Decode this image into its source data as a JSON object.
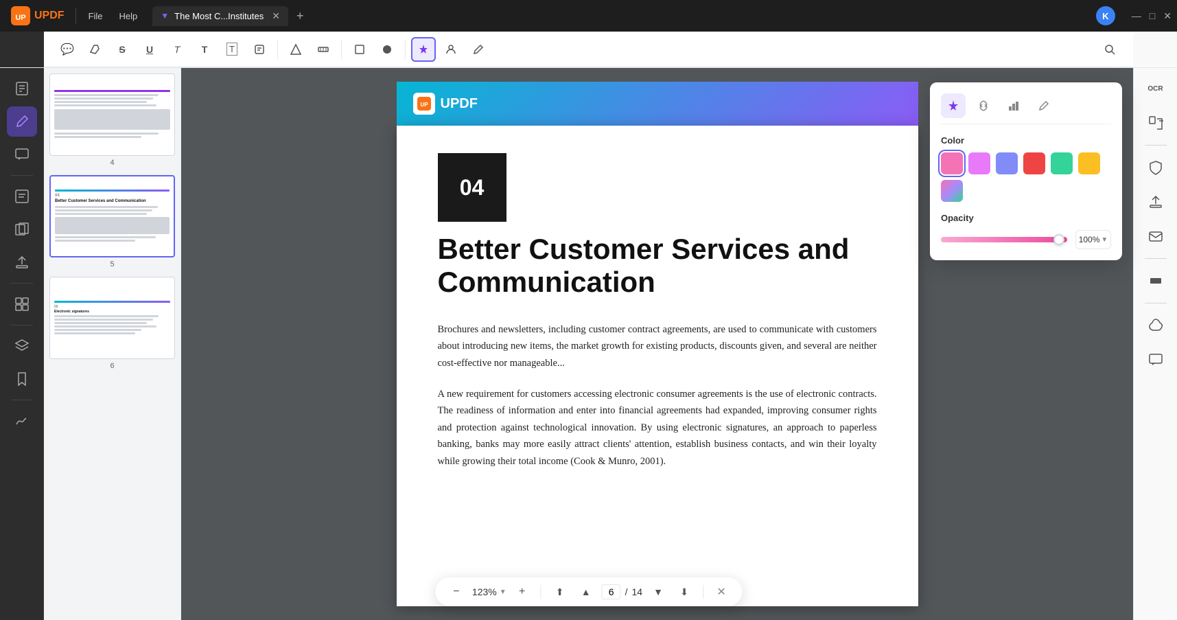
{
  "app": {
    "name": "UPDF",
    "logo_text": "UPDF"
  },
  "topbar": {
    "menu_items": [
      "File",
      "Help"
    ],
    "tab_title": "The Most C...Institutes",
    "tab_icon": "▼",
    "add_tab": "+",
    "avatar_letter": "K",
    "window_controls": [
      "—",
      "□",
      "✕"
    ]
  },
  "toolbar": {
    "tools": [
      {
        "name": "comment-icon",
        "symbol": "💬"
      },
      {
        "name": "highlight-icon",
        "symbol": "✏"
      },
      {
        "name": "strikethrough-icon",
        "symbol": "S"
      },
      {
        "name": "underline-icon",
        "symbol": "U"
      },
      {
        "name": "text-insert-icon",
        "symbol": "T"
      },
      {
        "name": "text-box-icon",
        "symbol": "T"
      },
      {
        "name": "text-edit-icon",
        "symbol": "T̲"
      },
      {
        "name": "stamp-icon",
        "symbol": "🖹"
      },
      {
        "name": "shape-icon",
        "symbol": "△"
      },
      {
        "name": "measure-icon",
        "symbol": "📐"
      },
      {
        "name": "rect-icon",
        "symbol": "□"
      },
      {
        "name": "color-icon",
        "symbol": "🎨"
      },
      {
        "name": "ai-sparkle-icon",
        "symbol": "✦"
      },
      {
        "name": "person-icon",
        "symbol": "👤"
      },
      {
        "name": "pen-icon",
        "symbol": "✒"
      },
      {
        "name": "search-icon",
        "symbol": "🔍"
      }
    ]
  },
  "color_picker": {
    "tabs": [
      {
        "name": "sparkle-tab",
        "symbol": "✦"
      },
      {
        "name": "link-tab",
        "symbol": "🔗"
      },
      {
        "name": "chart-tab",
        "symbol": "📊"
      },
      {
        "name": "edit-tab",
        "symbol": "✏"
      }
    ],
    "color_label": "Color",
    "colors": [
      {
        "value": "#f472b6",
        "selected": true
      },
      {
        "value": "#e879f9"
      },
      {
        "value": "#818cf8"
      },
      {
        "value": "#ef4444"
      },
      {
        "value": "#34d399"
      },
      {
        "value": "#fbbf24"
      },
      {
        "value": "#f472a0"
      }
    ],
    "opacity_label": "Opacity",
    "opacity_value": "100%"
  },
  "pdf": {
    "banner_logo": "UPDF",
    "section_number": "04",
    "page_title": "Better Customer Services and Communication",
    "body_paragraphs": [
      "Brochures and newsletters, including customer contract agreements, are used to communicate with customers about introducing new items, the market growth for existing products, discounts given, and several...",
      "A new require... electronic con... ments is the us... tracts. The read...",
      "of information and enter into financial agreements had expanded, improving consumer rights and protection against technological innovation. By using electronic signatures, an approach to paperless banking, banks may more easily attract clients' attention, establish business contacts, and win their loyalty while growing their total income (Cook & Munro, 2001)."
    ]
  },
  "thumbnails": [
    {
      "number": "4"
    },
    {
      "number": "5"
    },
    {
      "number": "6"
    }
  ],
  "pagination": {
    "current_page": "6",
    "total_pages": "14",
    "zoom_level": "123%"
  },
  "left_sidebar": {
    "tools": [
      {
        "name": "reader-icon",
        "symbol": "📖"
      },
      {
        "name": "annotate-icon",
        "symbol": "✏",
        "active": true
      },
      {
        "name": "comment-sidebar-icon",
        "symbol": "💬"
      },
      {
        "name": "edit-icon",
        "symbol": "✎"
      },
      {
        "name": "pages-icon",
        "symbol": "📄"
      },
      {
        "name": "export-icon",
        "symbol": "⬆"
      },
      {
        "name": "organize-icon",
        "symbol": "⊞"
      },
      {
        "name": "protect-icon",
        "symbol": "🔒"
      },
      {
        "name": "layers-icon",
        "symbol": "⬡"
      },
      {
        "name": "bookmark-icon",
        "symbol": "🔖"
      },
      {
        "name": "sign-icon",
        "symbol": "✒"
      }
    ]
  },
  "right_sidebar": {
    "tools": [
      {
        "name": "ocr-icon",
        "symbol": "OCR"
      },
      {
        "name": "convert-icon",
        "symbol": "⇄"
      },
      {
        "name": "protect-r-icon",
        "symbol": "🔒"
      },
      {
        "name": "share-icon",
        "symbol": "⬆"
      },
      {
        "name": "email-icon",
        "symbol": "✉"
      },
      {
        "name": "redact-icon",
        "symbol": "⬛"
      },
      {
        "name": "ai-r-icon",
        "symbol": "✦"
      },
      {
        "name": "chat-r-icon",
        "symbol": "💬"
      }
    ]
  }
}
